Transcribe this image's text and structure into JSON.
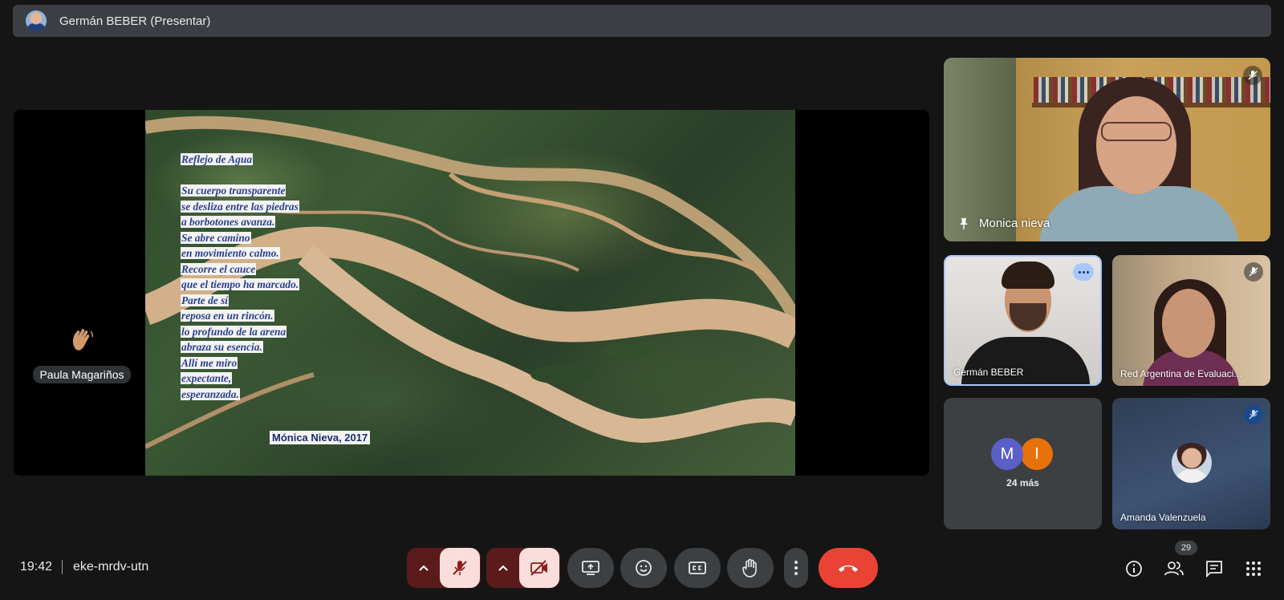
{
  "presenter_bar": {
    "title": "Germán BEBER (Presentar)"
  },
  "slide": {
    "poem_title": "Reflejo de Agua",
    "poem_lines": [
      "Su cuerpo transparente",
      "se desliza entre las piedras",
      "a borbotones avanza.",
      "Se abre camino",
      "en movimiento calmo.",
      "Recorre el cauce",
      "que el tiempo ha marcado.",
      "Parte de sí",
      "reposa en un rincón.",
      " lo profundo de la arena",
      " abraza su esencia.",
      "Allí me miro",
      "expectante,",
      "esperanzada."
    ],
    "author": "Mónica Nieva, 2017"
  },
  "raised_hand": {
    "name": "Paula Magariños",
    "icon": "waving-hand-icon"
  },
  "tiles": {
    "monica": {
      "name": "Monica nieva",
      "pinned": true,
      "muted": true
    },
    "german": {
      "name": "Germán BEBER"
    },
    "red": {
      "name": "Red Argentina de Evaluaci...",
      "muted": true
    },
    "more": {
      "initials": [
        "M",
        "I"
      ],
      "label": "24 más",
      "colors": [
        "#5b5fc7",
        "#e8710a"
      ]
    },
    "amanda": {
      "name": "Amanda Valenzuela",
      "muted": true
    }
  },
  "bottom_bar": {
    "time": "19:42",
    "meeting_code": "eke-mrdv-utn",
    "participants_count": "29",
    "colors": {
      "muted_bg": "#f9dedc",
      "muted_dark": "#5c1b1b",
      "hangup": "#ea4335",
      "pill": "#3c4043"
    }
  }
}
